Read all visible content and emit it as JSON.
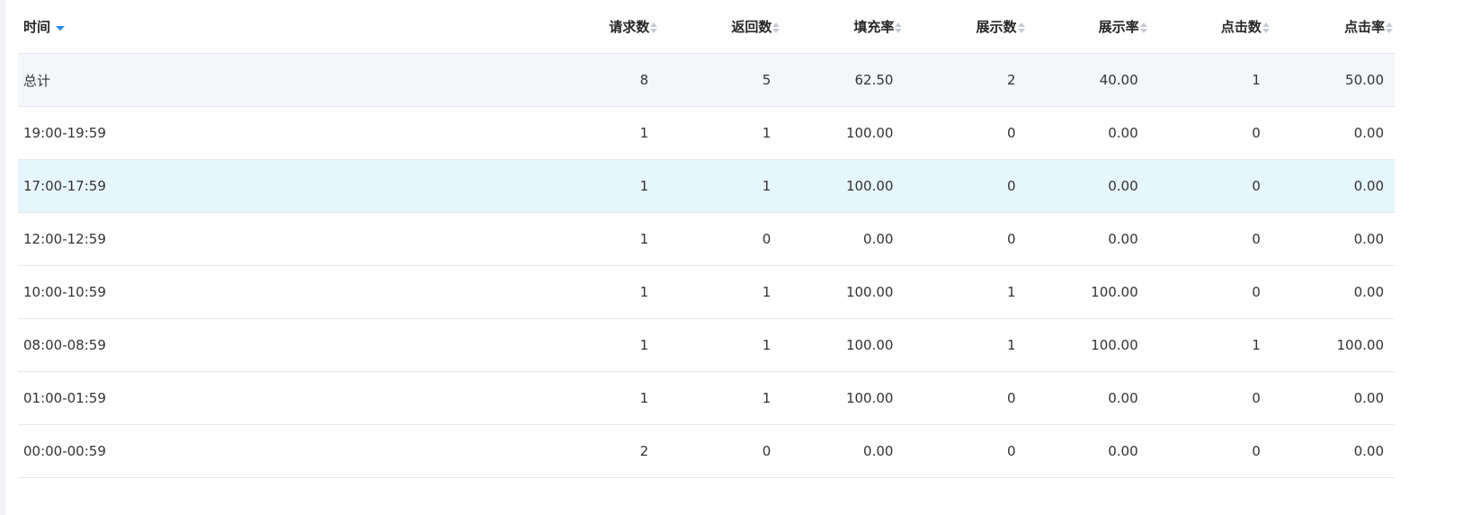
{
  "colors": {
    "accent": "#1e88e5",
    "total_row_bg": "#f3f7fa",
    "hover_row_bg": "#e6f6fd",
    "border": "#e4e7ec"
  },
  "table": {
    "columns": [
      {
        "key": "time",
        "label": "时间",
        "sort": "desc-active"
      },
      {
        "key": "requests",
        "label": "请求数",
        "sort": "none"
      },
      {
        "key": "returns",
        "label": "返回数",
        "sort": "none"
      },
      {
        "key": "fill_rate",
        "label": "填充率",
        "sort": "none"
      },
      {
        "key": "impressions",
        "label": "展示数",
        "sort": "none"
      },
      {
        "key": "impression_rate",
        "label": "展示率",
        "sort": "none"
      },
      {
        "key": "clicks",
        "label": "点击数",
        "sort": "none"
      },
      {
        "key": "ctr",
        "label": "点击率",
        "sort": "none"
      }
    ],
    "rows": [
      [
        "总计",
        "8",
        "5",
        "62.50",
        "2",
        "40.00",
        "1",
        "50.00"
      ],
      [
        "19:00-19:59",
        "1",
        "1",
        "100.00",
        "0",
        "0.00",
        "0",
        "0.00"
      ],
      [
        "17:00-17:59",
        "1",
        "1",
        "100.00",
        "0",
        "0.00",
        "0",
        "0.00"
      ],
      [
        "12:00-12:59",
        "1",
        "0",
        "0.00",
        "0",
        "0.00",
        "0",
        "0.00"
      ],
      [
        "10:00-10:59",
        "1",
        "1",
        "100.00",
        "1",
        "100.00",
        "0",
        "0.00"
      ],
      [
        "08:00-08:59",
        "1",
        "1",
        "100.00",
        "1",
        "100.00",
        "1",
        "100.00"
      ],
      [
        "01:00-01:59",
        "1",
        "1",
        "100.00",
        "0",
        "0.00",
        "0",
        "0.00"
      ],
      [
        "00:00-00:59",
        "2",
        "0",
        "0.00",
        "0",
        "0.00",
        "0",
        "0.00"
      ]
    ]
  }
}
